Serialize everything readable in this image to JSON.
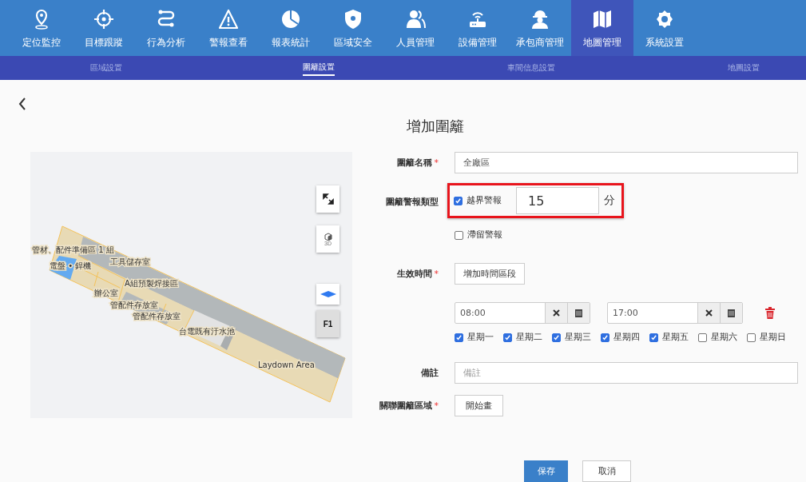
{
  "nav": {
    "items": [
      {
        "label": "定位監控",
        "selected": false
      },
      {
        "label": "目標跟蹤",
        "selected": false
      },
      {
        "label": "行為分析",
        "selected": false
      },
      {
        "label": "警報查看",
        "selected": false
      },
      {
        "label": "報表統計",
        "selected": false
      },
      {
        "label": "區域安全",
        "selected": false
      },
      {
        "label": "人員管理",
        "selected": false
      },
      {
        "label": "設備管理",
        "selected": false
      },
      {
        "label": "承包商管理",
        "selected": false
      },
      {
        "label": "地圖管理",
        "selected": true
      },
      {
        "label": "系統設置",
        "selected": false
      }
    ]
  },
  "subnav": {
    "items": [
      {
        "label": "區域設置",
        "selected": false
      },
      {
        "label": "圍籬設置",
        "selected": true
      },
      {
        "label": "車間信息設置",
        "selected": false
      },
      {
        "label": "地圖設置",
        "selected": false
      }
    ]
  },
  "title": "增加圍籬",
  "map": {
    "labels": [
      "管材、配件準備區 1 組",
      "電盤 • 銲機",
      "工具儲存室",
      "A組預製焊接區",
      "辦公室",
      "管配件存放室",
      "管配件存放室",
      "台電既有汙水池",
      "Laydown Area"
    ],
    "view_3d": "3D",
    "floor": "F1"
  },
  "form": {
    "name": {
      "label": "圍籬名稱",
      "mark": "*",
      "value": "全廠區"
    },
    "alarm_type": {
      "label": "圍籬警報類型",
      "options": [
        {
          "label": "越界警報",
          "checked": true,
          "minutes": "15",
          "unit": "分"
        },
        {
          "label": "滯留警報",
          "checked": false
        }
      ]
    },
    "effective_time": {
      "label": "生效時間",
      "mark": "*",
      "add_button": "增加時間區段",
      "periods": [
        {
          "start": "08:00",
          "end": "17:00",
          "days": [
            {
              "label": "星期一",
              "checked": true
            },
            {
              "label": "星期二",
              "checked": true
            },
            {
              "label": "星期三",
              "checked": true
            },
            {
              "label": "星期四",
              "checked": true
            },
            {
              "label": "星期五",
              "checked": true
            },
            {
              "label": "星期六",
              "checked": false
            },
            {
              "label": "星期日",
              "checked": false
            }
          ]
        }
      ]
    },
    "note": {
      "label": "備註",
      "placeholder": "備註"
    },
    "area": {
      "label": "關聯圍籬區域",
      "mark": "*",
      "button": "開始畫"
    }
  },
  "buttons": {
    "save": "保存",
    "cancel": "取消"
  }
}
